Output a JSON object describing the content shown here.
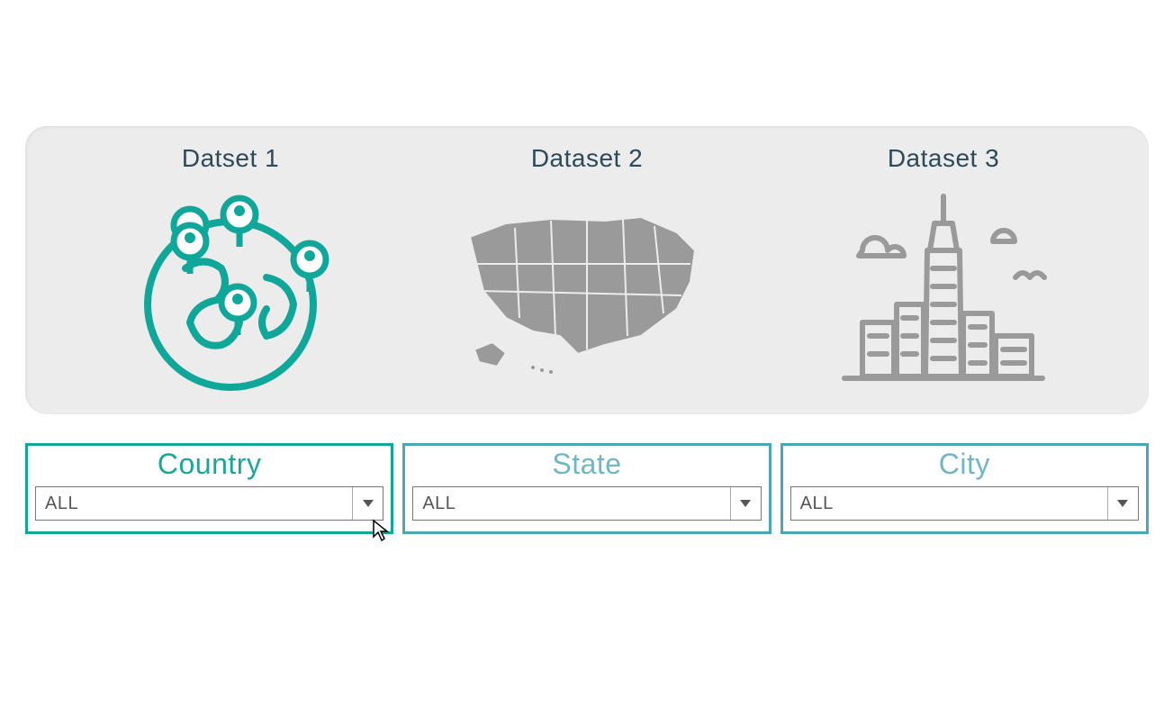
{
  "datasets": [
    {
      "title": "Datset 1",
      "icon": "globe"
    },
    {
      "title": "Dataset 2",
      "icon": "usa"
    },
    {
      "title": "Dataset 3",
      "icon": "city"
    }
  ],
  "filters": {
    "country": {
      "label": "Country",
      "value": "ALL"
    },
    "state": {
      "label": "State",
      "value": "ALL"
    },
    "city": {
      "label": "City",
      "value": "ALL"
    }
  },
  "colors": {
    "accent_primary": "#0fa79a",
    "accent_secondary": "#4aa7b8",
    "panel_bg": "#ececec",
    "icon_gray": "#9a9a9a",
    "text_dark": "#2d4a5a"
  }
}
